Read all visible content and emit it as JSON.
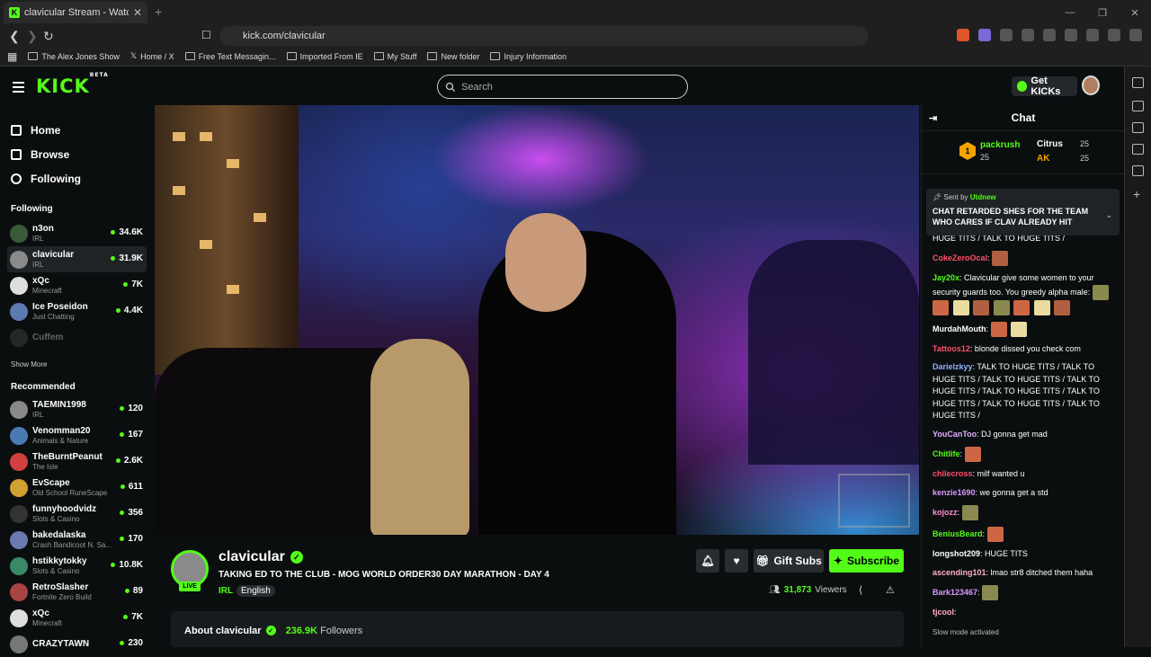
{
  "browser": {
    "tab_title": "clavicular Stream - Watch Liv",
    "url": "kick.com/clavicular",
    "bookmarks": [
      "The Alex Jones Show",
      "Home / X",
      "Free Text Messagin...",
      "Imported From IE",
      "My Stuff",
      "New folder",
      "Injury Information"
    ]
  },
  "header": {
    "logo": "KICK",
    "logo_tag": "BETA",
    "search_placeholder": "Search",
    "get_kicks": "Get KICKs"
  },
  "nav": {
    "items": [
      {
        "label": "Home",
        "icon": "home-icon"
      },
      {
        "label": "Browse",
        "icon": "browse-icon"
      },
      {
        "label": "Following",
        "icon": "heart-icon"
      }
    ],
    "following_title": "Following",
    "show_more": "Show More",
    "recommended_title": "Recommended"
  },
  "following": [
    {
      "name": "n3on",
      "category": "IRL",
      "viewers": "34.6K",
      "color": "#3a5a3a"
    },
    {
      "name": "clavicular",
      "category": "IRL",
      "viewers": "31.9K",
      "color": "#8a8a8a"
    },
    {
      "name": "xQc",
      "category": "Minecraft",
      "viewers": "7K",
      "color": "#ddd"
    },
    {
      "name": "Ice Poseidon",
      "category": "Just Chatting",
      "viewers": "4.4K",
      "color": "#5a7ab0"
    },
    {
      "name": "Cuffem",
      "category": "",
      "viewers": "",
      "color": "#555"
    }
  ],
  "recommended": [
    {
      "name": "TAEMIN1998",
      "category": "IRL",
      "viewers": "120",
      "color": "#888"
    },
    {
      "name": "Venomman20",
      "category": "Animals & Nature",
      "viewers": "167",
      "color": "#4a7ab0"
    },
    {
      "name": "TheBurntPeanut",
      "category": "The Isle",
      "viewers": "2.6K",
      "color": "#d04040"
    },
    {
      "name": "EvScape",
      "category": "Old School RuneScape",
      "viewers": "611",
      "color": "#d0a030"
    },
    {
      "name": "funnyhoodvidz",
      "category": "Slots & Casino",
      "viewers": "356",
      "color": "#333"
    },
    {
      "name": "bakedalaska",
      "category": "Crash Bandicoot N. Sa...",
      "viewers": "170",
      "color": "#6a7ab0"
    },
    {
      "name": "hstikkytokky",
      "category": "Slots & Casino",
      "viewers": "10.8K",
      "color": "#3a8a6a"
    },
    {
      "name": "RetroSlasher",
      "category": "Fortnite Zero Build",
      "viewers": "89",
      "color": "#aa4444"
    },
    {
      "name": "xQc",
      "category": "Minecraft",
      "viewers": "7K",
      "color": "#ddd"
    },
    {
      "name": "CRAZYTAWN",
      "category": "",
      "viewers": "230",
      "color": "#777"
    }
  ],
  "stream": {
    "channel": "clavicular",
    "live_label": "LIVE",
    "title": "TAKING ED TO THE CLUB - MOG WORLD ORDER30 DAY MARATHON - DAY 4",
    "category": "IRL",
    "language": "English",
    "gift_subs": "Gift Subs",
    "subscribe": "Subscribe",
    "viewers": "31,873",
    "viewers_label": "Viewers",
    "about_label": "About clavicular",
    "followers": "236.9K",
    "followers_label": "Followers"
  },
  "chat": {
    "title": "Chat",
    "gifters": [
      {
        "name": "packrush",
        "amount": "25"
      },
      {
        "name": "Citrus",
        "amount": "25"
      },
      {
        "name": "AK",
        "amount": "25"
      }
    ],
    "gifter_rank": "1",
    "pinned_by_label": "Sent by",
    "pinned_by": "Utdnew",
    "pinned_message": "CHAT RETARDED SHES FOR THE TEAM WHO CARES IF CLAV ALREADY HIT",
    "messages": [
      {
        "user": "",
        "text": "HUGE TITS / TALK TO HUGE TITS / TALK TO HUGE TITS / TALK TO HUGE TITS /",
        "color": "#ffffff",
        "emotes": 0
      },
      {
        "user": "CokeZeroOcal",
        "text": ":",
        "color": "#ff4f6a",
        "emotes": 1
      },
      {
        "user": "Jay20x",
        "text": ": Clavicular give some women to your security guards too. You greedy alpha male:",
        "color": "#53fc18",
        "emotes": 8
      },
      {
        "user": "MurdahMouth",
        "text": ":",
        "color": "#ffffff",
        "emotes": 2
      },
      {
        "user": "Tattoos12",
        "text": ": blonde dissed you check com",
        "color": "#ff4f6a",
        "emotes": 0
      },
      {
        "user": "Darielzkyy",
        "text": ": TALK TO HUGE TITS / TALK TO HUGE TITS / TALK TO HUGE TITS / TALK TO HUGE TITS / TALK TO HUGE TITS / TALK TO HUGE TITS / TALK TO HUGE TITS / TALK TO HUGE TITS /",
        "color": "#8fb0ff",
        "emotes": 0
      },
      {
        "user": "YouCanToo",
        "text": ": DJ gonna get mad",
        "color": "#e0b0ff",
        "emotes": 0
      },
      {
        "user": "Chitlife",
        "text": ":",
        "color": "#53fc18",
        "emotes": 1
      },
      {
        "user": "chilecross",
        "text": ": milf wanted u",
        "color": "#ff4f6a",
        "emotes": 0
      },
      {
        "user": "kenzie1690",
        "text": ": we gonna get a std",
        "color": "#d89aff",
        "emotes": 0
      },
      {
        "user": "kojozz",
        "text": ":",
        "color": "#ff8fd0",
        "emotes": 1
      },
      {
        "user": "BeniusBeard",
        "text": ":",
        "color": "#53fc18",
        "emotes": 1
      },
      {
        "user": "longshot209",
        "text": ": HUGE TITS",
        "color": "#ffffff",
        "emotes": 0
      },
      {
        "user": "ascending101",
        "text": ": lmao str8 ditched them haha",
        "color": "#ffb0c0",
        "emotes": 0
      },
      {
        "user": "Bark123467",
        "text": ":",
        "color": "#d89aff",
        "emotes": 1
      },
      {
        "user": "tjcool",
        "text": ":",
        "color": "#ffb0c0",
        "emotes": 0
      }
    ],
    "slow_mode": "Slow mode activated"
  }
}
